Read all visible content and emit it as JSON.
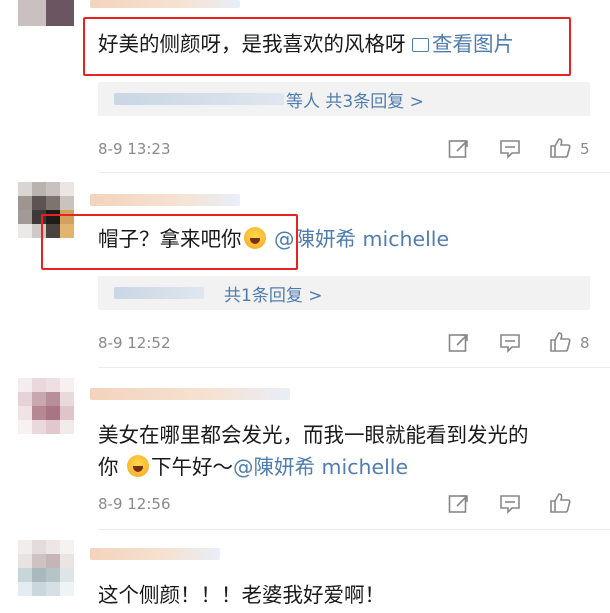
{
  "comments": [
    {
      "text": "好美的侧颜呀，是我喜欢的风格呀",
      "view_image": "查看图片",
      "replies": "等人 共3条回复 >",
      "time": "8-9 13:23",
      "likes": "5"
    },
    {
      "text": "帽子？拿来吧你",
      "mention": "@陳妍希 michelle",
      "replies": "共1条回复 >",
      "time": "8-9 12:52",
      "likes": "8"
    },
    {
      "line1": "美女在哪里都会发光，而我一眼就能看到发光的",
      "line2_pre": "你",
      "line2_post": "下午好～",
      "mention": "@陳妍希 michelle",
      "time": "8-9 12:56",
      "likes": ""
    },
    {
      "text": "这个侧颜！！！老婆我好爱啊！"
    }
  ],
  "icons": {
    "share": "share-icon",
    "comment": "comment-icon",
    "like": "thumbs-up-icon",
    "image": "image-icon",
    "emoji": "laughing-emoji-icon"
  },
  "colors": {
    "link": "#507daf",
    "highlight": "#e8231f",
    "meta": "#8a8a8a"
  }
}
